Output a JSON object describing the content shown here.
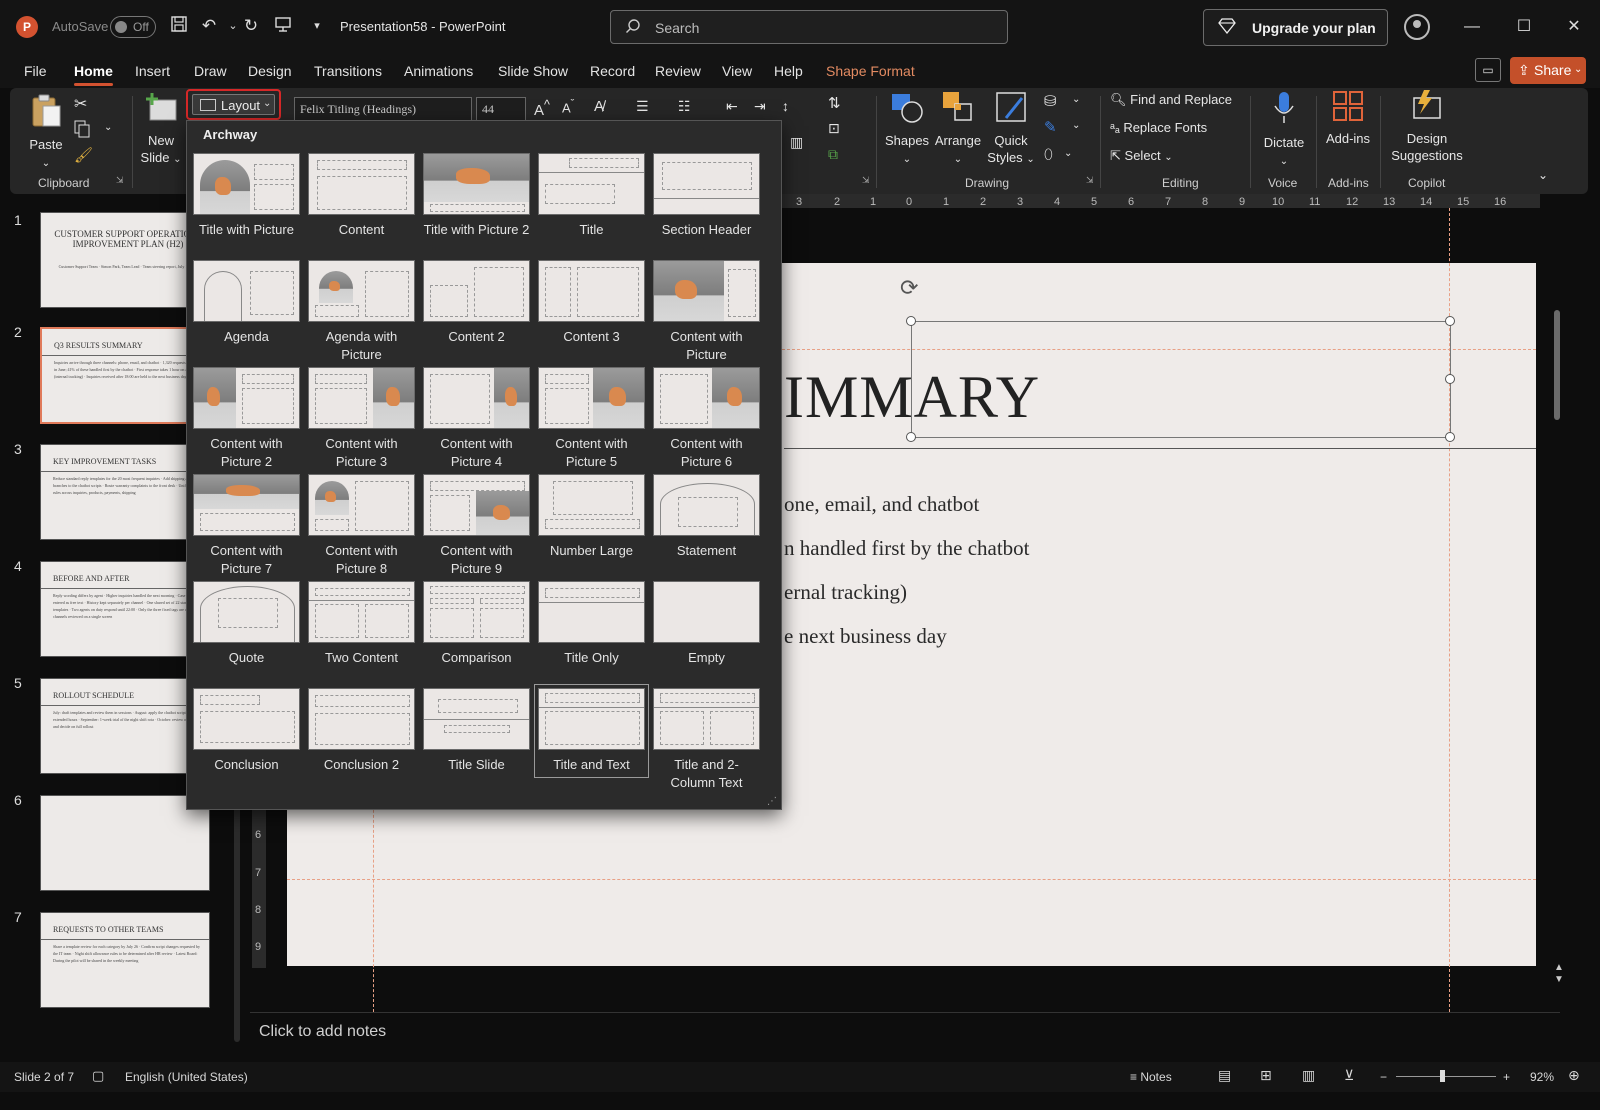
{
  "titlebar": {
    "app_badge": "P",
    "autosave_label": "AutoSave",
    "autosave_state": "Off",
    "doc_title": "Presentation58  -  PowerPoint",
    "search_placeholder": "Search",
    "upgrade_label": "Upgrade your plan"
  },
  "menu": {
    "tabs": [
      "File",
      "Home",
      "Insert",
      "Draw",
      "Design",
      "Transitions",
      "Animations",
      "Slide Show",
      "Record",
      "Review",
      "View",
      "Help",
      "Shape Format"
    ],
    "active": "Home",
    "share_label": "Share"
  },
  "ribbon": {
    "paste": "Paste",
    "new_slide_1": "New",
    "new_slide_2": "Slide",
    "layout": "Layout",
    "font_name": "Felix Titling (Headings)",
    "font_size": "44",
    "clipboard_group": "Clipboard",
    "shapes": "Shapes",
    "arrange": "Arrange",
    "quick_styles_1": "Quick",
    "quick_styles_2": "Styles",
    "drawing_group": "Drawing",
    "find_replace": "Find and Replace",
    "replace_fonts": "Replace Fonts",
    "select": "Select",
    "editing_group": "Editing",
    "dictate": "Dictate",
    "voice_group": "Voice",
    "addins": "Add-ins",
    "addins_group": "Add-ins",
    "design_1": "Design",
    "design_2": "Suggestions",
    "copilot_group": "Copilot"
  },
  "gallery": {
    "theme": "Archway",
    "layouts": [
      "Title with Picture",
      "Content",
      "Title with Picture 2",
      "Title",
      "Section Header",
      "Agenda",
      "Agenda with Picture",
      "Content 2",
      "Content 3",
      "Content with Picture",
      "Content with Picture 2",
      "Content with Picture 3",
      "Content with Picture 4",
      "Content with Picture 5",
      "Content with Picture 6",
      "Content with Picture 7",
      "Content with Picture 8",
      "Content with Picture 9",
      "Number Large",
      "Statement",
      "Quote",
      "Two Content",
      "Comparison",
      "Title Only",
      "Empty",
      "Conclusion",
      "Conclusion 2",
      "Title Slide",
      "Title and Text",
      "Title and 2-Column Text"
    ],
    "selected": "Title and Text"
  },
  "thumbnails": [
    {
      "num": "1",
      "title": "CUSTOMER SUPPORT OPERATIONS IMPROVEMENT PLAN (H2)",
      "body": "Customer Support Team · Simon Park, Team Lead · Team steering report, July 15, 2024"
    },
    {
      "num": "2",
      "title": "Q3 RESULTS SUMMARY",
      "body": "Inquiries arrive through three channels: phone, email, and chatbot · 1,320 requests received in June; 41% of these handled first by the chatbot · First response takes 1 hour on average (internal tracking) · Inquiries received after 18:00 are held to the next business day"
    },
    {
      "num": "3",
      "title": "KEY IMPROVEMENT TASKS",
      "body": "Reduce standard reply templates for the 20 most frequent inquiries · Add shipping and refund branches to the chatbot scripts · Route warranty complaints to the front desk · Unify case tag rules across inquiries, products, payments, shipping"
    },
    {
      "num": "4",
      "title": "BEFORE AND AFTER",
      "body": "Reply wording differs by agent · Higher inquiries handled the next morning · Case tags entered as free text · History kept separately per channel · One shared set of 22 standard templates · Two agents on duty respond until 22:00 · Only the three fixed tags are used · All channels reviewed on a single screen"
    },
    {
      "num": "5",
      "title": "ROLLOUT SCHEDULE",
      "body": "July: draft templates and review them in sessions · August: apply the chatbot script and test extended hours · September: 1-week trial of the night shift rota · October: review of job results and decide on full rollout"
    },
    {
      "num": "6",
      "title": "",
      "body": ""
    },
    {
      "num": "7",
      "title": "REQUESTS TO OTHER TEAMS",
      "body": "Share a template review for each category by July 26 · Confirm script changes requested by the IT team · Night shift allowance rules to be determined after HR review · Latest Board: During the pilot will be shared in the weekly meeting"
    }
  ],
  "slide": {
    "title_visible": "IMMARY",
    "bullets": [
      "one, email, and chatbot",
      "n handled first by the chatbot",
      "ernal tracking)",
      "e next business day"
    ]
  },
  "notes_placeholder": "Click to add notes",
  "status": {
    "slide_pos": "Slide 2 of 7",
    "language": "English (United States)",
    "notes_label": "Notes",
    "zoom": "92%"
  },
  "ruler": {
    "h_ticks": [
      "3",
      "2",
      "1",
      "0",
      "1",
      "2",
      "3",
      "4",
      "5",
      "6",
      "7",
      "8",
      "9",
      "10",
      "11",
      "12",
      "13",
      "14",
      "15",
      "16"
    ],
    "v_ticks": [
      "6",
      "7",
      "8",
      "9"
    ]
  },
  "colors": {
    "accent": "#d35230",
    "selection_outline": "#d62828",
    "shape_format": "#e38b62"
  }
}
